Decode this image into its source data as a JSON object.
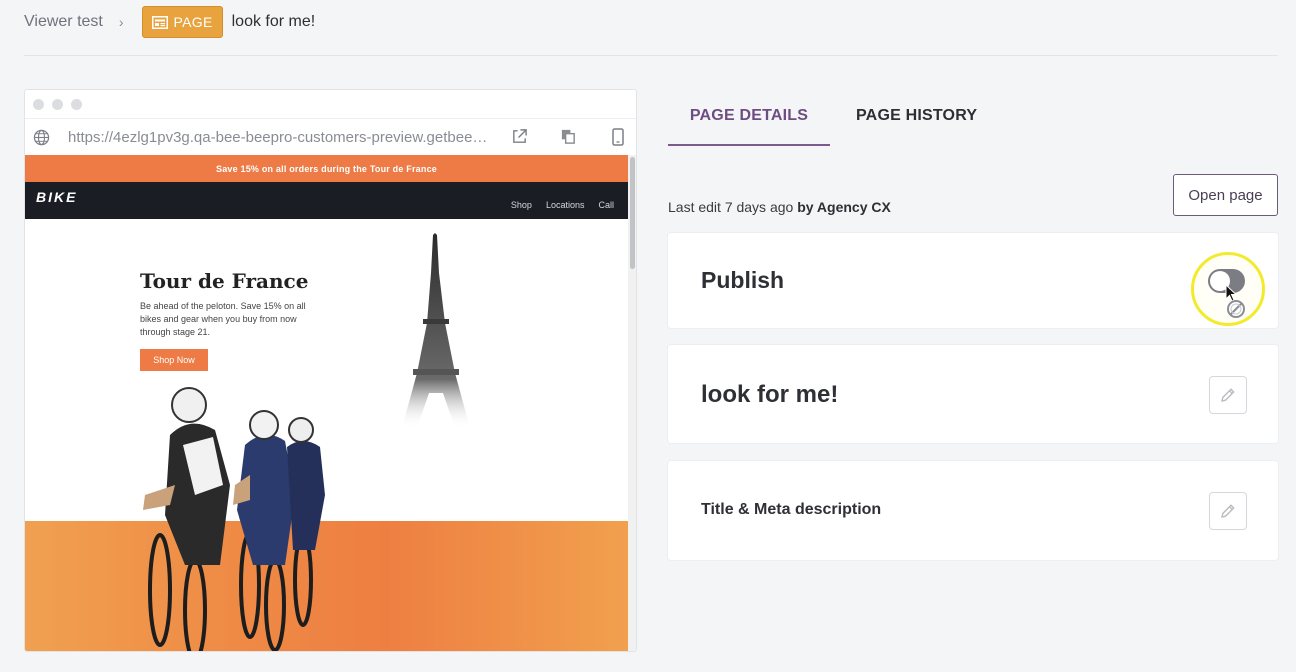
{
  "breadcrumb": {
    "root": "Viewer test",
    "separator": "›",
    "badge_label": "PAGE",
    "current": "look for me!"
  },
  "browser": {
    "url": "https://4ezlg1pv3g.qa-bee-beepro-customers-preview.getbee.i...",
    "icons": [
      "globe-icon",
      "external-link-icon",
      "copy-icon",
      "mobile-icon"
    ]
  },
  "preview": {
    "promo": "Save 15% on all orders during the Tour de France",
    "logo": "BIKE",
    "nav": [
      "Shop",
      "Locations",
      "Call"
    ],
    "hero_title": "Tour de France",
    "hero_body": "Be ahead of the peloton. Save 15% on all bikes and gear when you buy from now through stage 21.",
    "cta": "Shop Now"
  },
  "tabs": {
    "details": "PAGE DETAILS",
    "history": "PAGE HISTORY",
    "active": "details"
  },
  "details": {
    "last_edit_prefix": "Last edit 7 days ago",
    "last_edit_by": "by Agency CX",
    "open_page": "Open page",
    "publish_label": "Publish",
    "publish_on": false,
    "page_title": "look for me!",
    "meta_label": "Title & Meta description"
  },
  "colors": {
    "badge": "#e8a33e",
    "accent": "#7b5a8e",
    "promo": "#ee7b45",
    "highlight": "#f2ea2b"
  }
}
